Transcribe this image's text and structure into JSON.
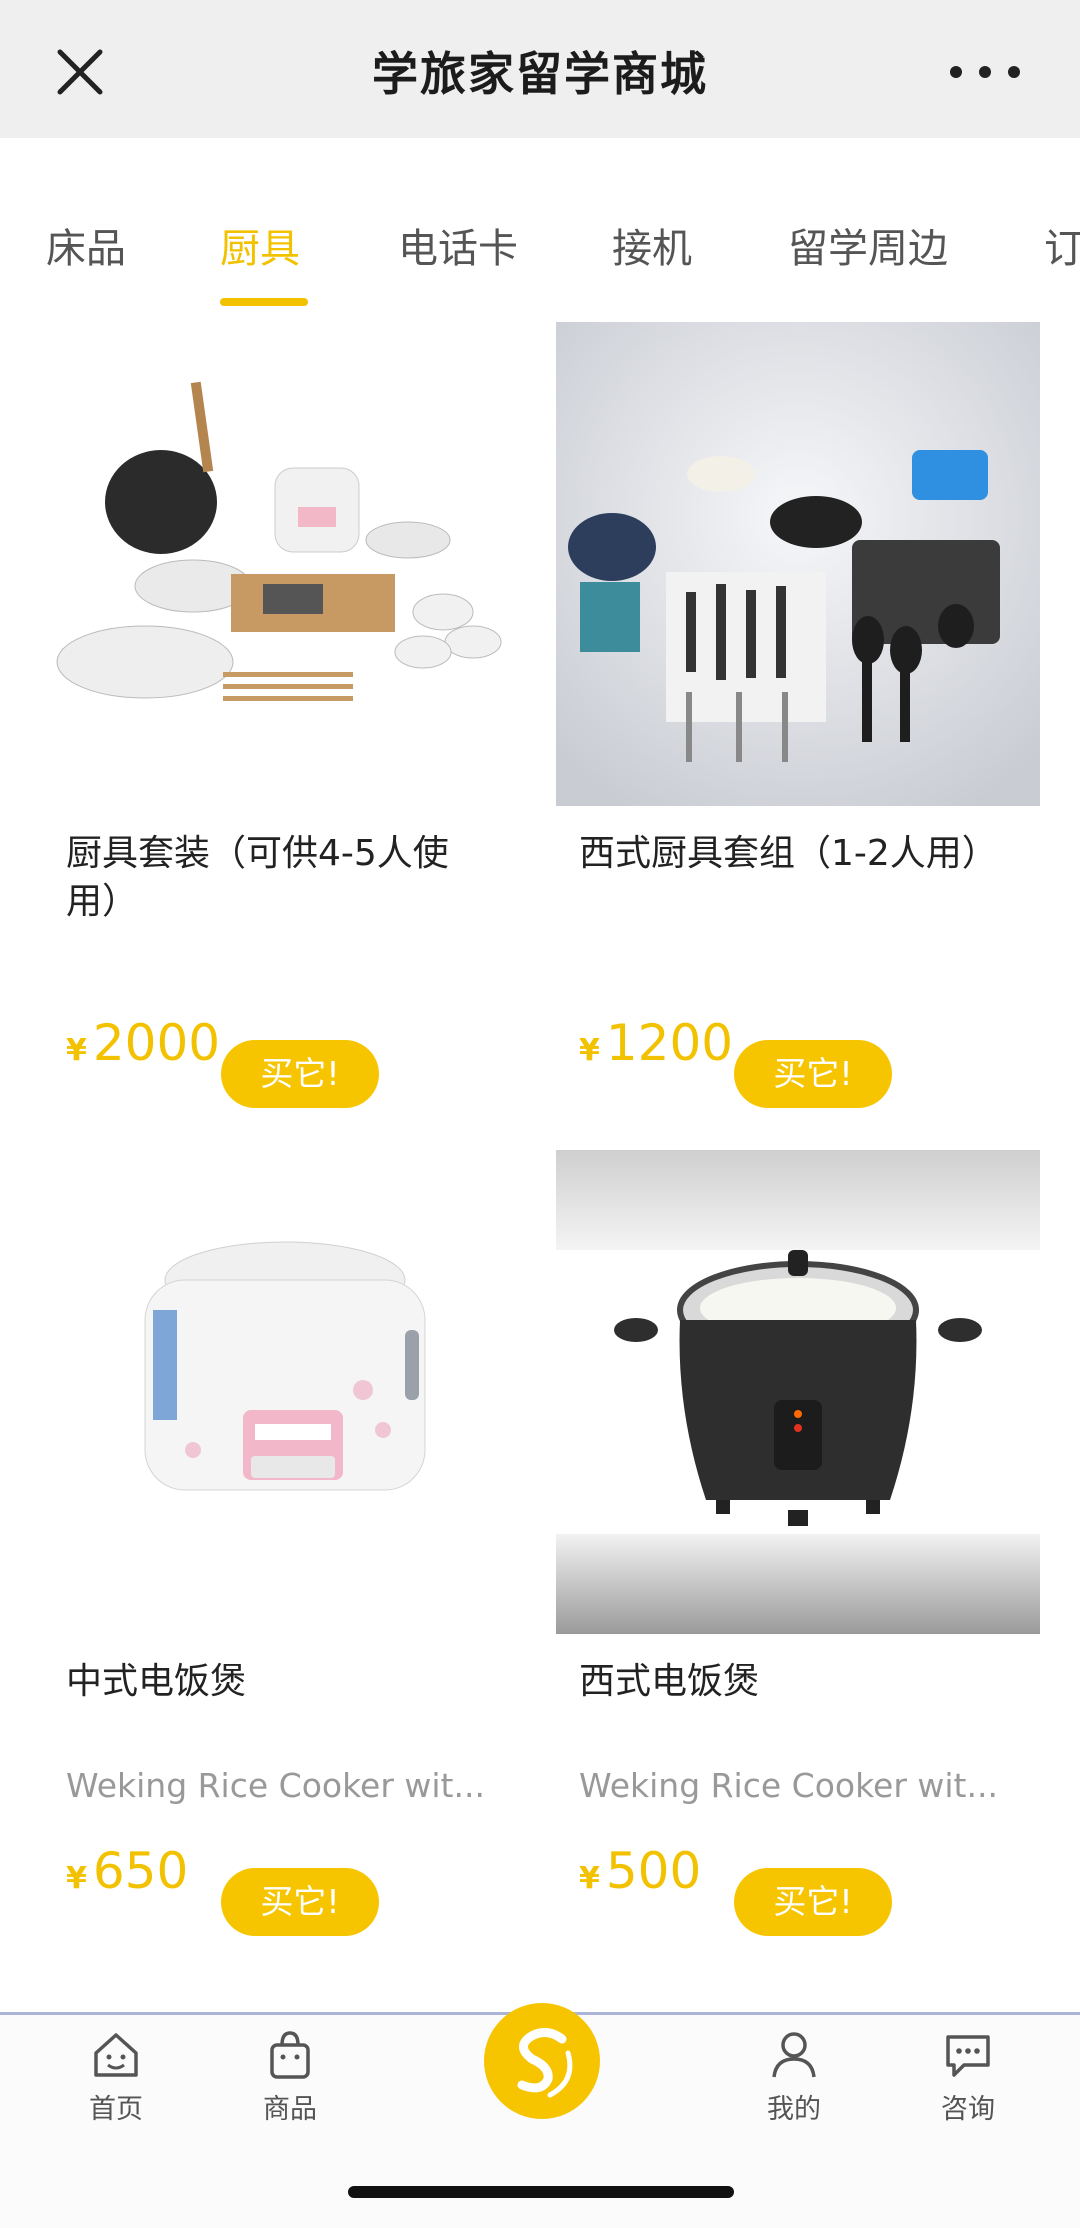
{
  "header": {
    "title": "学旅家留学商城",
    "close_icon": "close-icon",
    "more_icon": "more-horizontal-icon"
  },
  "tabs": [
    {
      "label": "床品",
      "active": false
    },
    {
      "label": "厨具",
      "active": true
    },
    {
      "label": "电话卡",
      "active": false
    },
    {
      "label": "接机",
      "active": false
    },
    {
      "label": "留学周边",
      "active": false
    },
    {
      "label": "订",
      "active": false
    }
  ],
  "products": [
    {
      "name": "厨具套装（可供4-5人使用）",
      "subtitle": "",
      "currency": "¥",
      "price": "2000",
      "buy_label": "买它!"
    },
    {
      "name": "西式厨具套组（1-2人用）",
      "subtitle": "",
      "currency": "¥",
      "price": "1200",
      "buy_label": "买它!"
    },
    {
      "name": "中式电饭煲",
      "subtitle": "Weking Rice Cooker wit...",
      "currency": "¥",
      "price": "650",
      "buy_label": "买它!"
    },
    {
      "name": "西式电饭煲",
      "subtitle": "Weking Rice Cooker wit...",
      "currency": "¥",
      "price": "500",
      "buy_label": "买它!"
    }
  ],
  "bottom_nav": {
    "home": "首页",
    "products": "商品",
    "mine": "我的",
    "consult": "咨询"
  },
  "colors": {
    "accent": "#f7c500",
    "title_bar": "#efefef"
  }
}
